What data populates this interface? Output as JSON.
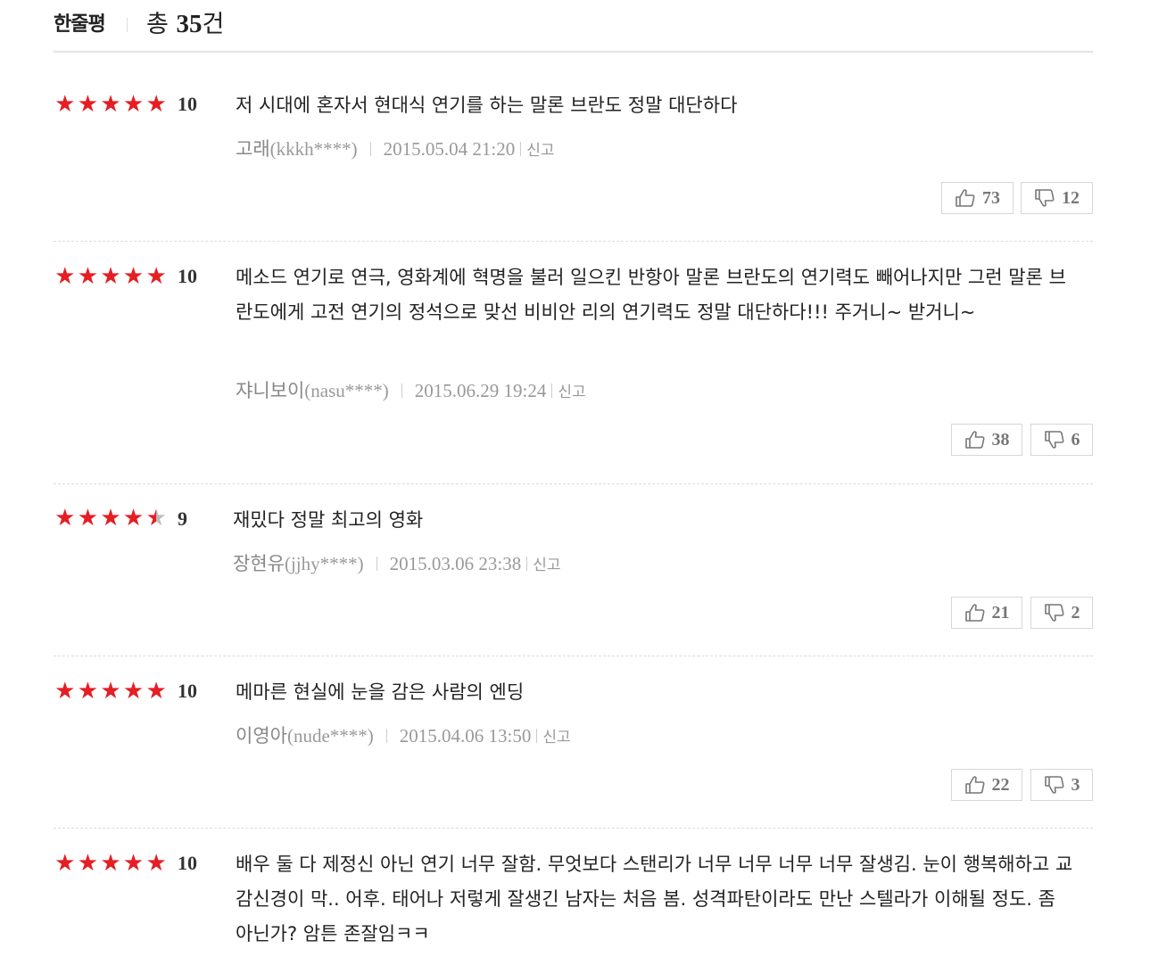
{
  "header": {
    "title": "한줄평",
    "total_prefix": "총",
    "total_count": "35",
    "total_suffix": "건"
  },
  "report_label": "신고",
  "colors": {
    "star_on": "#e51e24",
    "star_off": "#bbbbbb"
  },
  "reviews": [
    {
      "rating": 10,
      "stars": 5,
      "score": "10",
      "text": "저 시대에 혼자서 현대식 연기를 하는 말론 브란도 정말 대단하다",
      "author": "고래",
      "user_id": "(kkkh****)",
      "date": "2015.05.04 21:20",
      "likes": "73",
      "dislikes": "12"
    },
    {
      "rating": 10,
      "stars": 5,
      "score": "10",
      "text": "메소드 연기로 연극, 영화계에 혁명을 불러 일으킨 반항아 말론 브란도의 연기력도 빼어나지만 그런 말론 브란도에게 고전 연기의 정석으로 맞선 비비안 리의 연기력도 정말 대단하다!!! 주거니~ 받거니~",
      "author": "쟈니보이",
      "user_id": "(nasu****)",
      "date": "2015.06.29 19:24",
      "likes": "38",
      "dislikes": "6"
    },
    {
      "rating": 9,
      "stars": 4.5,
      "score": "9",
      "text": "재밌다 정말 최고의 영화",
      "author": "장현유",
      "user_id": "(jjhy****)",
      "date": "2015.03.06 23:38",
      "likes": "21",
      "dislikes": "2"
    },
    {
      "rating": 10,
      "stars": 5,
      "score": "10",
      "text": "메마른 현실에 눈을 감은 사람의 엔딩",
      "author": "이영아",
      "user_id": "(nude****)",
      "date": "2015.04.06 13:50",
      "likes": "22",
      "dislikes": "3"
    },
    {
      "rating": 10,
      "stars": 5,
      "score": "10",
      "text": "배우 둘 다 제정신 아닌 연기 너무 잘함. 무엇보다 스탠리가 너무 너무 너무 너무 잘생김. 눈이 행복해하고 교감신경이 막.. 어후. 태어나 저렇게 잘생긴 남자는 처음 봄. 성격파탄이라도 만난 스텔라가 이해될 정도. 좀 아닌가? 암튼 존잘임ㅋㅋ"
    }
  ]
}
